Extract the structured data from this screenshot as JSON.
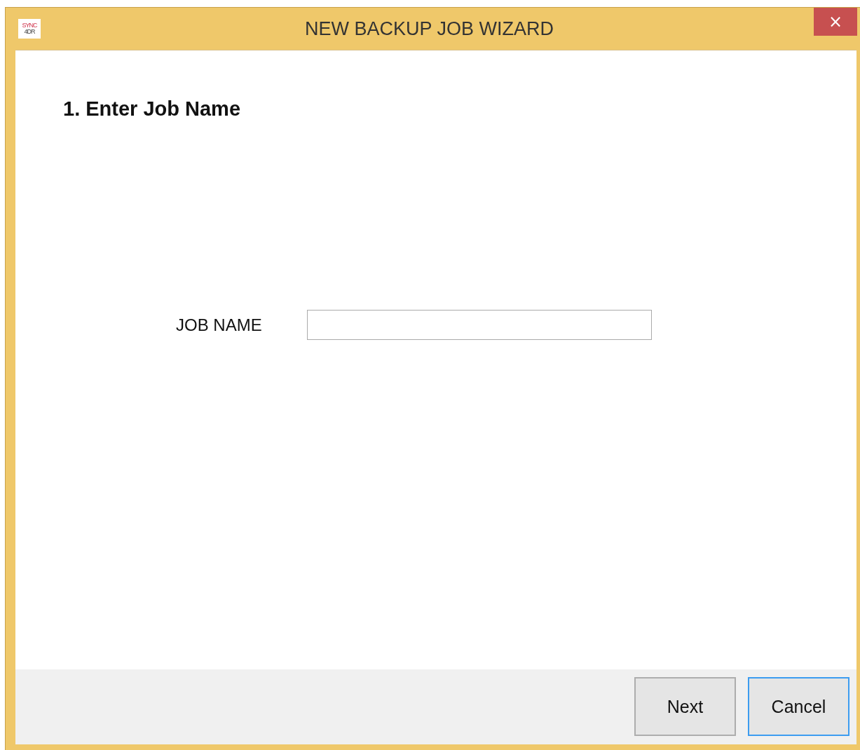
{
  "window": {
    "title": "NEW BACKUP JOB WIZARD",
    "logo": [
      "SYNC",
      "4DR"
    ],
    "close": "×"
  },
  "step": {
    "heading": "1. Enter Job Name"
  },
  "field": {
    "label": "JOB NAME"
  },
  "buttons": [
    {
      "label": "Next",
      "focused": false
    },
    {
      "label": "Cancel",
      "focused": true
    }
  ]
}
